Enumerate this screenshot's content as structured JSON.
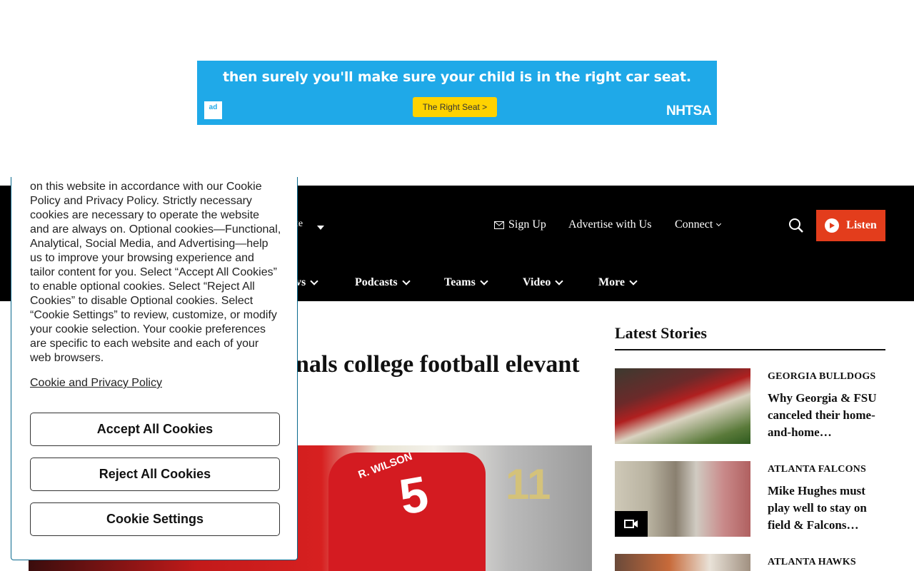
{
  "ad": {
    "headline": "then surely you'll make sure your child is in the right car seat.",
    "cta": "The Right Seat >",
    "logo": "ad",
    "brand": "NHTSA"
  },
  "header": {
    "partial_nav_label": "te",
    "utility": {
      "signup": "Sign Up",
      "advertise": "Advertise with Us",
      "connect": "Connect"
    },
    "listen_label": "Listen",
    "main_nav": {
      "partial": "vs",
      "podcasts": "Podcasts",
      "teams": "Teams",
      "video": "Video",
      "more": "More"
    }
  },
  "article": {
    "title": "nals college football elevant",
    "hero_name": "R. WILSON",
    "hero_number": "5",
    "hero_number_2": "11"
  },
  "sidebar": {
    "title": "Latest Stories",
    "stories": [
      {
        "category": "GEORGIA BULLDOGS",
        "headline": "Why Georgia & FSU canceled their home-and-home…"
      },
      {
        "category": "ATLANTA FALCONS",
        "headline": "Mike Hughes must play well to stay on field & Falcons…"
      },
      {
        "category": "ATLANTA HAWKS",
        "headline": ""
      }
    ]
  },
  "cookie": {
    "text": "on this website in accordance with our Cookie Policy and Privacy Policy. Strictly necessary cookies are necessary to operate the website and are always on. Optional cookies—Functional, Analytical, Social Media, and Advertising—help us to improve your browsing experience and tailor content for you. Select “Accept All Cookies” to enable optional cookies. Select “Reject All Cookies” to disable Optional cookies. Select “Cookie Settings” to review, customize, or modify your cookie selection. Your cookie preferences are specific to each website and each of your web browsers.",
    "policy_link": "Cookie and Privacy Policy",
    "accept": "Accept All Cookies",
    "reject": "Reject All Cookies",
    "settings": "Cookie Settings"
  },
  "colors": {
    "ad_bg": "#1fa9e8",
    "listen": "#e33d1c",
    "header": "#000000"
  },
  "icons": [
    "mail-icon",
    "search-icon",
    "play-icon",
    "chevron-down-icon",
    "video-camera-icon"
  ]
}
